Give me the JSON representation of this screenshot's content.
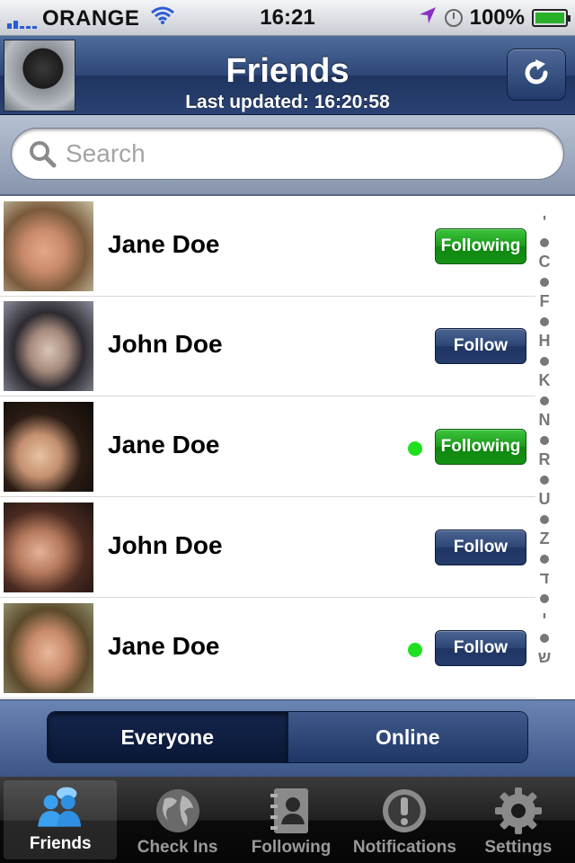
{
  "status_bar": {
    "carrier": "ORANGE",
    "time": "16:21",
    "battery": "100%"
  },
  "header": {
    "title": "Friends",
    "subtitle": "Last updated: 16:20:58"
  },
  "search": {
    "placeholder": "Search",
    "value": ""
  },
  "friends": [
    {
      "name": "Jane Doe",
      "button": "Following",
      "following": true,
      "online": false
    },
    {
      "name": "John Doe",
      "button": "Follow",
      "following": false,
      "online": false
    },
    {
      "name": "Jane Doe",
      "button": "Following",
      "following": true,
      "online": true
    },
    {
      "name": "John Doe",
      "button": "Follow",
      "following": false,
      "online": false
    },
    {
      "name": "Jane Doe",
      "button": "Follow",
      "following": false,
      "online": true
    }
  ],
  "index_letters": [
    "'",
    "•",
    "C",
    "•",
    "F",
    "•",
    "H",
    "•",
    "K",
    "•",
    "N",
    "•",
    "R",
    "•",
    "U",
    "•",
    "Z",
    "•",
    "ד",
    "•",
    "י",
    "•",
    "ש"
  ],
  "segments": {
    "everyone": "Everyone",
    "online": "Online"
  },
  "tabs": [
    {
      "label": "Friends",
      "icon": "friends-icon",
      "selected": true
    },
    {
      "label": "Check Ins",
      "icon": "globe-icon",
      "selected": false
    },
    {
      "label": "Following",
      "icon": "address-book-icon",
      "selected": false
    },
    {
      "label": "Notifications",
      "icon": "exclamation-icon",
      "selected": false
    },
    {
      "label": "Settings",
      "icon": "gear-icon",
      "selected": false
    }
  ],
  "colors": {
    "nav_blue": "#2d4777",
    "following_green": "#1c9a1c",
    "online_dot": "#1fe01f",
    "tab_active": "#2f8fe0"
  }
}
